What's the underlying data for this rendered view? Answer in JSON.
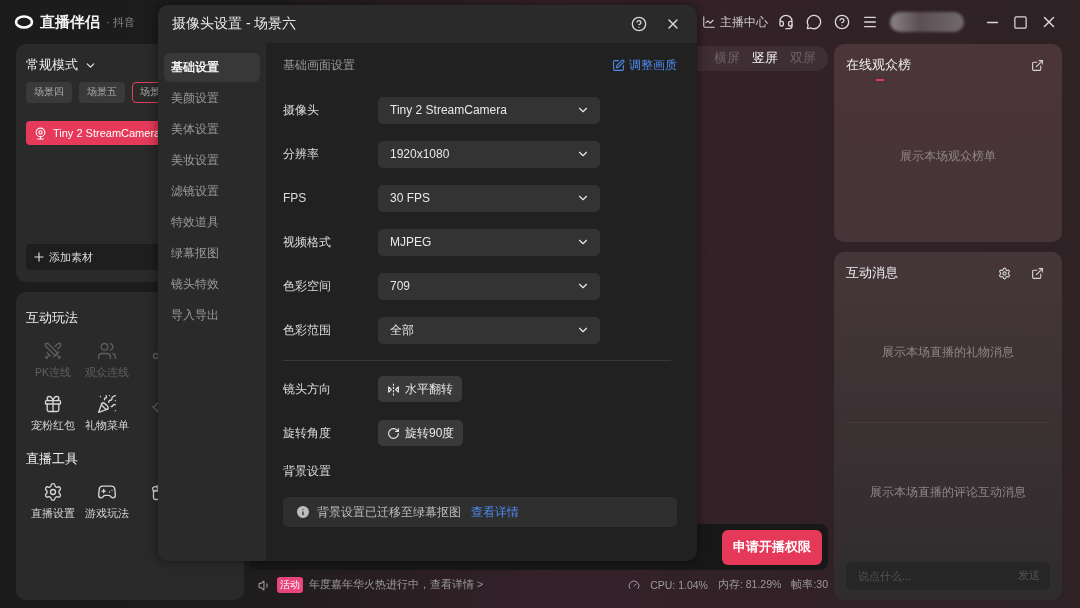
{
  "app": {
    "name": "直播伴侣",
    "platform": "· 抖音",
    "creator_center": "主播中心"
  },
  "left_panel": {
    "mode": "常规模式",
    "scenes": [
      {
        "label": "场景四",
        "selected": false
      },
      {
        "label": "场景五",
        "selected": false
      },
      {
        "label": "场景",
        "selected": true
      }
    ],
    "sources": [
      {
        "label": "Tiny 2 StreamCamera",
        "selected": true
      }
    ],
    "add_source": "添加素材",
    "sections": [
      {
        "title": "互动玩法",
        "items": [
          {
            "kind": "pk",
            "label": "PK连线",
            "disabled": true
          },
          {
            "kind": "link",
            "label": "观众连线",
            "disabled": true
          },
          {
            "kind": "music",
            "disabled": true
          },
          {
            "kind": "redpacket",
            "label": "宠粉红包",
            "disabled": false
          },
          {
            "kind": "giftmenu",
            "label": "礼物菜单",
            "disabled": false
          },
          {
            "kind": "heart",
            "disabled": true
          }
        ]
      },
      {
        "title": "直播工具",
        "items": [
          {
            "kind": "settings",
            "label": "直播设置",
            "disabled": false
          },
          {
            "kind": "game",
            "label": "游戏玩法",
            "disabled": false
          },
          {
            "kind": "material",
            "disabled": false
          }
        ]
      }
    ]
  },
  "center": {
    "orientation_tabs": [
      {
        "label": "横屏",
        "selected": false
      },
      {
        "label": "竖屏",
        "selected": true
      },
      {
        "label": "双屏",
        "selected": false
      }
    ],
    "apply_button": "申请开播权限",
    "footer": {
      "badge": "活动",
      "notice": "年度嘉年华火热进行中，查看详情 >",
      "stats": [
        "CPU: 1.04%",
        "内存: 81.29%",
        "帧率:30"
      ]
    }
  },
  "right_panel": {
    "audience": {
      "title": "在线观众榜",
      "empty": "展示本场观众榜单"
    },
    "messages": {
      "title": "互动消息",
      "gift_empty": "展示本场直播的礼物消息",
      "comment_empty": "展示本场直播的评论互动消息",
      "placeholder": "说点什么...",
      "send": "发送"
    }
  },
  "dialog": {
    "title": "摄像头设置 - 场景六",
    "nav": [
      {
        "label": "基础设置",
        "selected": true
      },
      {
        "label": "美颜设置",
        "selected": false
      },
      {
        "label": "美体设置",
        "selected": false
      },
      {
        "label": "美妆设置",
        "selected": false
      },
      {
        "label": "滤镜设置",
        "selected": false
      },
      {
        "label": "特效道具",
        "selected": false
      },
      {
        "label": "绿幕抠图",
        "selected": false
      },
      {
        "label": "镜头特效",
        "selected": false
      },
      {
        "label": "导入导出",
        "selected": false
      }
    ],
    "section": "基础画面设置",
    "adjust_link": "调整画质",
    "selects": [
      {
        "label": "摄像头",
        "value": "Tiny 2 StreamCamera"
      },
      {
        "label": "分辨率",
        "value": "1920x1080"
      },
      {
        "label": "FPS",
        "value": "30 FPS"
      },
      {
        "label": "视频格式",
        "value": "MJPEG"
      },
      {
        "label": "色彩空间",
        "value": "709"
      },
      {
        "label": "色彩范围",
        "value": "全部"
      }
    ],
    "actions": [
      {
        "label": "镜头方向",
        "button": "水平翻转",
        "kind": "flip"
      },
      {
        "label": "旋转角度",
        "button": "旋转90度",
        "kind": "rotate"
      }
    ],
    "background": {
      "label": "背景设置",
      "notice": "背景设置已迁移至绿幕抠图",
      "link": "查看详情"
    }
  }
}
